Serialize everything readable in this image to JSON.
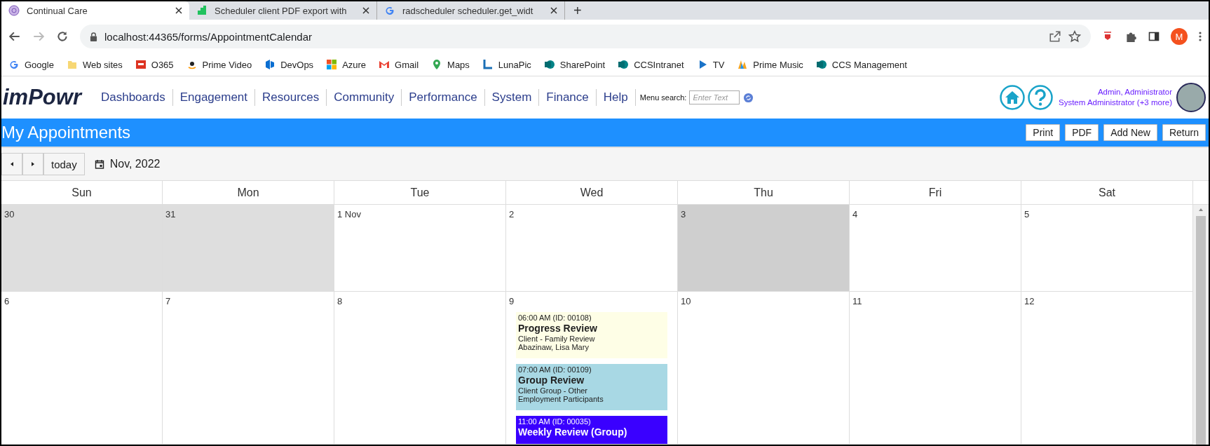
{
  "browser": {
    "tabs": [
      {
        "title": "Continual Care",
        "selected": true
      },
      {
        "title": "Scheduler client PDF export with",
        "selected": false
      },
      {
        "title": "radscheduler scheduler.get_widt",
        "selected": false
      }
    ],
    "new_tab": "+",
    "address": "localhost:44365/forms/AppointmentCalendar",
    "profile_initial": "M",
    "bookmarks": [
      "Google",
      "Web sites",
      "O365",
      "Prime Video",
      "DevOps",
      "Azure",
      "Gmail",
      "Maps",
      "LunaPic",
      "SharePoint",
      "CCSIntranet",
      "TV",
      "Prime Music",
      "CCS Management"
    ]
  },
  "app": {
    "logo": "imPowr",
    "menu": [
      "Dashboards",
      "Engagement",
      "Resources",
      "Community",
      "Performance",
      "System",
      "Finance",
      "Help"
    ],
    "menu_search": {
      "label": "Menu search:",
      "placeholder": "Enter Text"
    },
    "user": {
      "name": "Admin, Administrator",
      "role": "System Administrator (+3 more)"
    }
  },
  "page": {
    "title": "My Appointments",
    "buttons": [
      "Print",
      "PDF",
      "Add New",
      "Return"
    ]
  },
  "calendar": {
    "today_button": "today",
    "period": "Nov, 2022",
    "days": [
      "Sun",
      "Mon",
      "Tue",
      "Wed",
      "Thu",
      "Fri",
      "Sat"
    ],
    "weeks": [
      {
        "cells": [
          {
            "date": "30",
            "other_month": true,
            "today": false
          },
          {
            "date": "31",
            "other_month": true,
            "today": false
          },
          {
            "date": "1 Nov",
            "other_month": false,
            "today": false
          },
          {
            "date": "2",
            "other_month": false,
            "today": false
          },
          {
            "date": "3",
            "other_month": false,
            "today": true
          },
          {
            "date": "4",
            "other_month": false,
            "today": false
          },
          {
            "date": "5",
            "other_month": false,
            "today": false
          }
        ]
      },
      {
        "cells": [
          {
            "date": "6",
            "other_month": false,
            "today": false
          },
          {
            "date": "7",
            "other_month": false,
            "today": false
          },
          {
            "date": "8",
            "other_month": false,
            "today": false
          },
          {
            "date": "9",
            "other_month": false,
            "today": false,
            "events": [
              {
                "time": "06:00 AM (ID: 00108)",
                "title": "Progress Review",
                "lines": [
                  "Client - Family Review",
                  "Abazinaw, Lisa Mary"
                ],
                "color": "#fefee6"
              },
              {
                "time": "07:00 AM (ID: 00109)",
                "title": "Group Review",
                "lines": [
                  "Client Group - Other",
                  "Employment Participants"
                ],
                "color": "#a8d8e4"
              },
              {
                "time": "11:00 AM (ID: 00035)",
                "title": "Weekly Review (Group)",
                "color": "#3a00ff"
              }
            ]
          },
          {
            "date": "10",
            "other_month": false,
            "today": false
          },
          {
            "date": "11",
            "other_month": false,
            "today": false
          },
          {
            "date": "12",
            "other_month": false,
            "today": false
          }
        ]
      }
    ]
  }
}
